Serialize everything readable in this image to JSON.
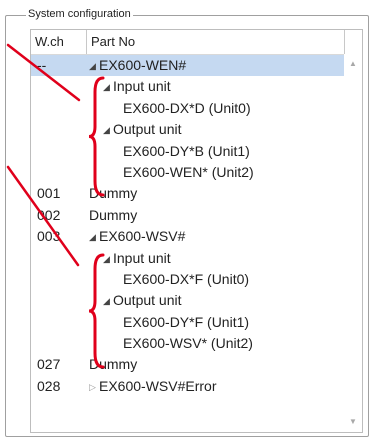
{
  "group": {
    "title": "System configuration"
  },
  "columns": {
    "wch": "W.ch",
    "part": "Part No"
  },
  "rows": [
    {
      "wch": "--",
      "label": "EX600-WEN#",
      "level": 0,
      "expander": "expanded",
      "selected": true
    },
    {
      "wch": "",
      "label": "Input unit",
      "level": 1,
      "expander": "expanded"
    },
    {
      "wch": "",
      "label": "EX600-DX*D (Unit0)",
      "level": 2,
      "expander": "none"
    },
    {
      "wch": "",
      "label": "Output unit",
      "level": 1,
      "expander": "expanded"
    },
    {
      "wch": "",
      "label": "EX600-DY*B (Unit1)",
      "level": 2,
      "expander": "none"
    },
    {
      "wch": "",
      "label": "EX600-WEN* (Unit2)",
      "level": 2,
      "expander": "none"
    },
    {
      "wch": "001",
      "label": "Dummy",
      "level": 0,
      "expander": "none"
    },
    {
      "wch": "002",
      "label": "Dummy",
      "level": 0,
      "expander": "none"
    },
    {
      "wch": "003",
      "label": "EX600-WSV#",
      "level": 0,
      "expander": "expanded"
    },
    {
      "wch": "",
      "label": "Input unit",
      "level": 1,
      "expander": "expanded"
    },
    {
      "wch": "",
      "label": "EX600-DX*F (Unit0)",
      "level": 2,
      "expander": "none"
    },
    {
      "wch": "",
      "label": "Output unit",
      "level": 1,
      "expander": "expanded"
    },
    {
      "wch": "",
      "label": "EX600-DY*F (Unit1)",
      "level": 2,
      "expander": "none"
    },
    {
      "wch": "",
      "label": "EX600-WSV* (Unit2)",
      "level": 2,
      "expander": "none"
    },
    {
      "wch": "027",
      "label": "Dummy",
      "level": 0,
      "expander": "none"
    },
    {
      "wch": "028",
      "label": "EX600-WSV#Error",
      "level": 0,
      "expander": "collapsed"
    }
  ],
  "annotation": {
    "color": "#e0001b"
  },
  "selection_color": "#c5d9f1"
}
